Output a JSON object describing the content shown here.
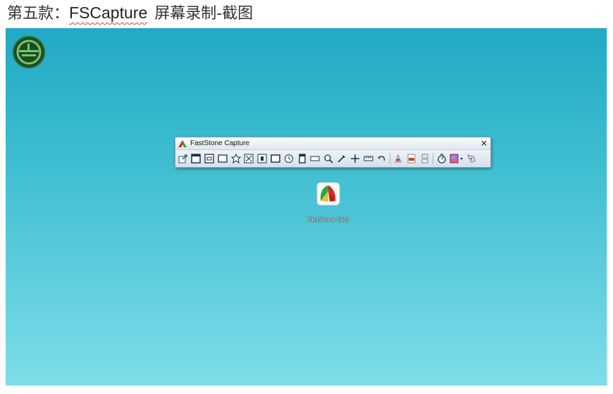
{
  "article": {
    "prefix": "第五款：",
    "app_name": "FSCapture",
    "suffix": "屏幕录制-截图"
  },
  "desktop": {
    "background_top": "#21a9c6",
    "background_bottom": "#7edde8",
    "corner_icon": "green-circle-logo-icon",
    "shortcut": {
      "icon": "faststone-capture-icon",
      "label": "FastStone Capture"
    }
  },
  "capture_toolbar": {
    "title": "FastStone Capture",
    "close_label": "×",
    "tools": [
      "open-in-editor-icon",
      "capture-active-window-icon",
      "capture-window-object-icon",
      "capture-rectangle-icon",
      "capture-freehand-icon",
      "capture-full-screen-icon",
      "capture-scrolling-window-icon",
      "capture-fixed-region-icon",
      "delayed-capture-icon",
      "screen-recorder-icon",
      "screen-ruler-icon",
      "magnifier-icon",
      "color-picker-icon",
      "crosshair-icon",
      "ruler-icon",
      "undo-icon",
      "output-to-editor-icon",
      "pdf-output-icon",
      "convert-images-icon",
      "timer-icon",
      "color-settings-icon",
      "settings-menu-icon"
    ]
  }
}
